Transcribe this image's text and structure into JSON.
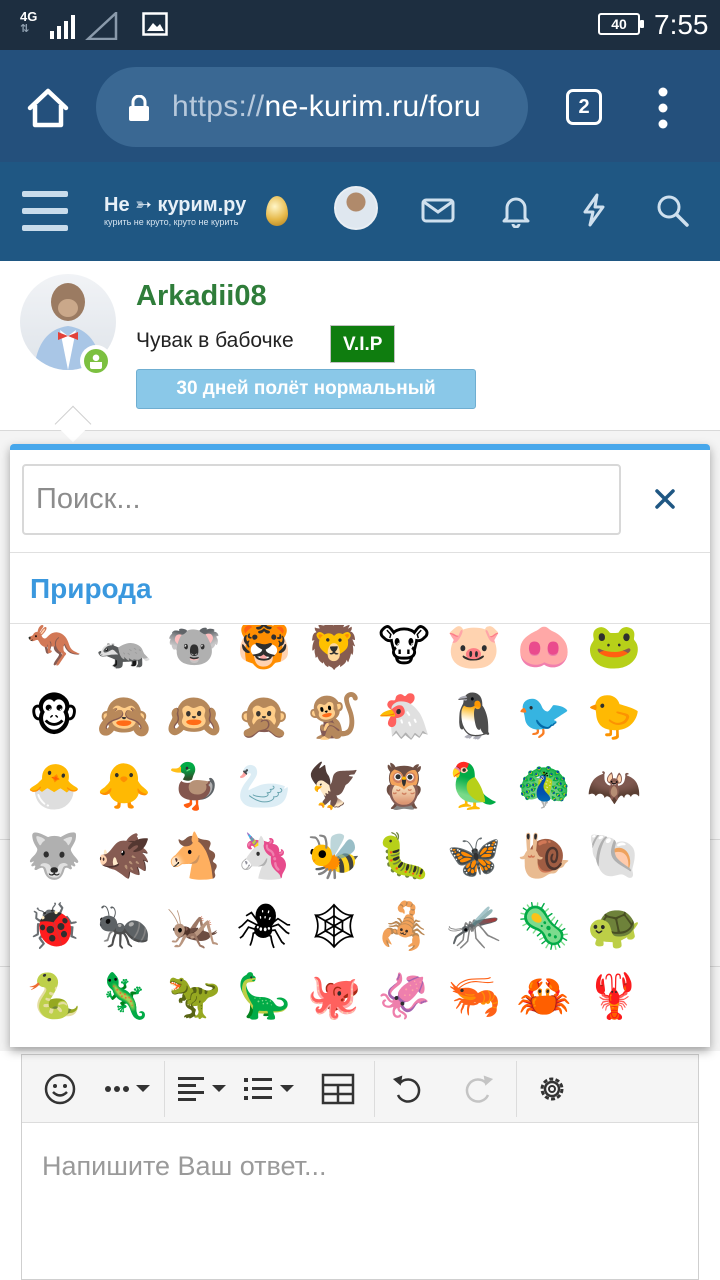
{
  "status_bar": {
    "network": "4G",
    "battery": "40",
    "time": "7:55"
  },
  "browser": {
    "url_scheme": "https://",
    "url_host": "ne-kurim.ru/foru",
    "tab_count": "2"
  },
  "site": {
    "logo_main": "Не ➳ курим.ру",
    "logo_sub": "курить не круто, круто не курить"
  },
  "profile": {
    "username": "Arkadii08",
    "user_title": "Чувак в бабочке",
    "badge": "V.I.P",
    "banner": "30 дней полёт нормальный"
  },
  "emoji_picker": {
    "search_placeholder": "Поиск...",
    "category": "Природа",
    "rows": [
      [
        "🦘",
        "🦡",
        "🐨",
        "🐯",
        "🦁",
        "🐮",
        "🐷",
        "🐽",
        "🐸"
      ],
      [
        "🐵",
        "🙈",
        "🙉",
        "🙊",
        "🐒",
        "🐔",
        "🐧",
        "🐦",
        "🐤"
      ],
      [
        "🐣",
        "🐥",
        "🦆",
        "🦢",
        "🦅",
        "🦉",
        "🦜",
        "🦚",
        "🦇"
      ],
      [
        "🐺",
        "🐗",
        "🐴",
        "🦄",
        "🐝",
        "🐛",
        "🦋",
        "🐌",
        "🐚"
      ],
      [
        "🐞",
        "🐜",
        "🦗",
        "🕷",
        "🕸",
        "🦂",
        "🦟",
        "🦠",
        "🐢"
      ],
      [
        "🐍",
        "🦎",
        "🦖",
        "🦕",
        "🐙",
        "🦑",
        "🦐",
        "🦀",
        "🦞"
      ]
    ]
  },
  "editor": {
    "placeholder": "Напишите Ваш ответ..."
  },
  "colors": {
    "status_bar": "#1d2e40",
    "browser_bar": "#24507c",
    "site_header": "#1f5783",
    "accent": "#47a7eb",
    "username": "#2f7d3a",
    "vip": "#0f7d0f",
    "banner": "#8ac8e8"
  }
}
